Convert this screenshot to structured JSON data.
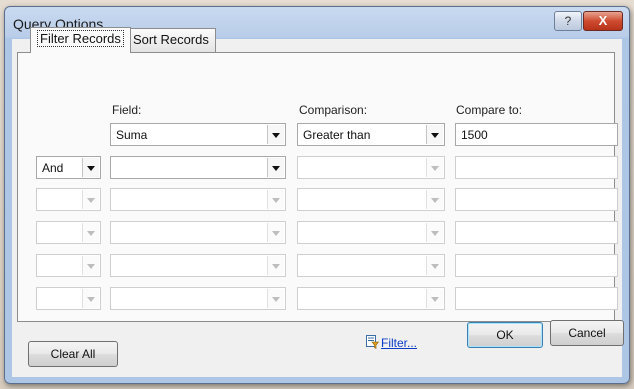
{
  "window": {
    "title": "Query Options",
    "help_glyph": "?",
    "close_glyph": "X"
  },
  "tabs": [
    {
      "label": "Filter Records",
      "active": true
    },
    {
      "label": "Sort Records",
      "active": false
    }
  ],
  "headers": {
    "field": "Field:",
    "comparison": "Comparison:",
    "compare_to": "Compare to:"
  },
  "rows": [
    {
      "connector": "",
      "field": "Suma",
      "comparison": "Greater than",
      "compare_to": "1500",
      "enabled": true
    },
    {
      "connector": "And",
      "field": "",
      "comparison": "",
      "compare_to": "",
      "enabled": true
    },
    {
      "connector": "",
      "field": "",
      "comparison": "",
      "compare_to": "",
      "enabled": false
    },
    {
      "connector": "",
      "field": "",
      "comparison": "",
      "compare_to": "",
      "enabled": false
    },
    {
      "connector": "",
      "field": "",
      "comparison": "",
      "compare_to": "",
      "enabled": false
    },
    {
      "connector": "",
      "field": "",
      "comparison": "",
      "compare_to": "",
      "enabled": false
    }
  ],
  "buttons": {
    "clear_all": "Clear All",
    "filter": "Filter...",
    "ok": "OK",
    "cancel": "Cancel"
  },
  "icons": {
    "filter": "filter-funnel-icon"
  },
  "colors": {
    "accent": "#0a3cc8",
    "default_button_border": "#3c7fb1"
  }
}
